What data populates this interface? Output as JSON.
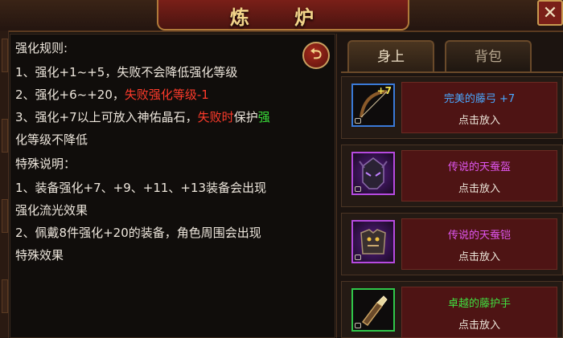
{
  "header": {
    "title": "炼 炉",
    "close_symbol": "✕"
  },
  "rules": {
    "heading": "强化规则:",
    "rule1": "1、强化+1~+5，失败不会降低强化等级",
    "rule2_prefix": "2、强化+6~+20，",
    "rule2_red": "失败强化等级-1",
    "rule3_prefix": "3、强化+7以上可放入神佑晶石，",
    "rule3_red": "失败时",
    "rule3_mid": "保护",
    "rule3_green_a": "强",
    "rule3_green_b": "化等级不降低",
    "special_heading": "特殊说明：",
    "special1_a": "1、装备强化+7、+9、+11、+13装备会出现",
    "special1_b": "强化流光效果",
    "special2_a": "2、佩戴8件强化+20的装备，角色周围会出现",
    "special2_b": "特殊效果"
  },
  "back_button": {
    "icon": "return-arrow-icon",
    "symbol": "⮌"
  },
  "tabs": [
    {
      "label": "身上",
      "active": true
    },
    {
      "label": "背包",
      "active": false
    }
  ],
  "items": [
    {
      "name": "完美的藤弓 +7",
      "action": "点击放入",
      "badge": "+7",
      "icon": "bow-icon",
      "quality": "blue"
    },
    {
      "name": "传说的天蚕盔",
      "action": "点击放入",
      "badge": "",
      "icon": "helmet-icon",
      "quality": "purple"
    },
    {
      "name": "传说的天蚕铠",
      "action": "点击放入",
      "badge": "",
      "icon": "armor-icon",
      "quality": "purple"
    },
    {
      "name": "卓越的藤护手",
      "action": "点击放入",
      "badge": "",
      "icon": "gauntlet-icon",
      "quality": "green"
    }
  ],
  "colors": {
    "heading_yellow": "#f0c84a",
    "warning_red": "#ff3b2b",
    "success_green": "#3ae03a",
    "quality_blue": "#4aa8ff",
    "quality_purple": "#e056f0",
    "quality_green": "#40e040"
  }
}
